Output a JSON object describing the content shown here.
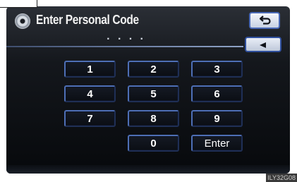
{
  "header": {
    "icon": "disc-icon",
    "title": "Enter Personal Code",
    "back_icon": "back-arrow-icon"
  },
  "code_display": {
    "masked_value": "· · · ·"
  },
  "delete_button": {
    "icon": "left-triangle-icon"
  },
  "keypad": {
    "keys": [
      "1",
      "2",
      "3",
      "4",
      "5",
      "6",
      "7",
      "8",
      "9",
      "0",
      "Enter"
    ]
  },
  "watermark": "ILY32G08",
  "colors": {
    "accent_blue": "#4e6fb5",
    "panel_dark": "#07090c"
  }
}
